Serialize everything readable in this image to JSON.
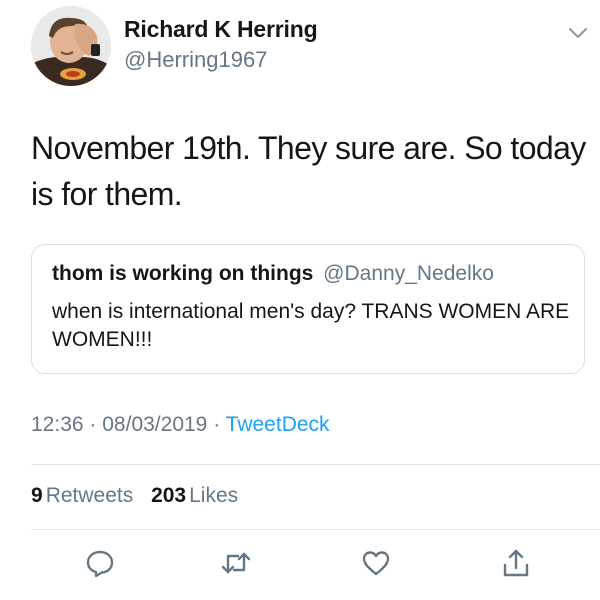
{
  "author": {
    "display_name": "Richard K Herring",
    "handle": "@Herring1967"
  },
  "tweet": {
    "text": "November 19th. They sure are. So today is for them."
  },
  "quoted_tweet": {
    "display_name": "thom is working on things",
    "handle": "@Danny_Nedelko",
    "text": "when is international men's day? TRANS WOMEN ARE WOMEN!!!"
  },
  "meta": {
    "time": "12:36",
    "separator": "·",
    "date": "08/03/2019",
    "source": "TweetDeck"
  },
  "stats": {
    "retweets_count": "9",
    "retweets_label": "Retweets",
    "likes_count": "203",
    "likes_label": "Likes"
  },
  "actions": [
    {
      "icon": "reply-icon"
    },
    {
      "icon": "retweet-icon"
    },
    {
      "icon": "like-icon"
    },
    {
      "icon": "share-icon"
    }
  ],
  "colors": {
    "text_primary": "#14171a",
    "text_secondary": "#657786",
    "link_blue": "#1da1f2",
    "border": "#e1e8ed"
  }
}
